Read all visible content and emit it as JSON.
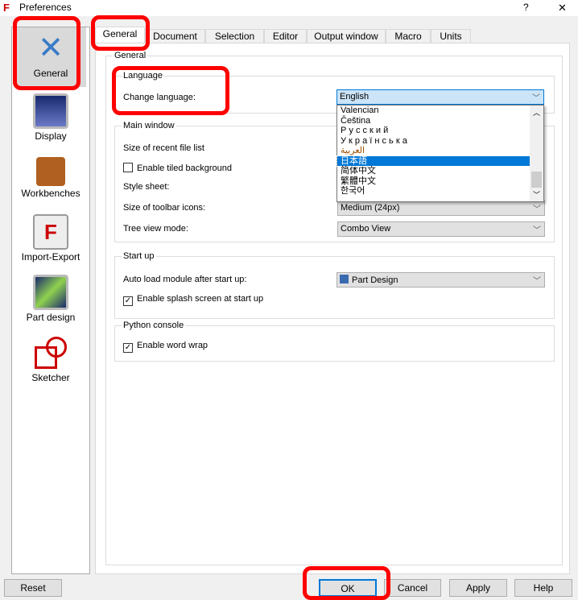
{
  "window": {
    "title": "Preferences",
    "help": "?",
    "close": "✕"
  },
  "sidebar": {
    "items": [
      {
        "label": "General",
        "icon": "wrench-screwdriver-icon"
      },
      {
        "label": "Display",
        "icon": "monitor-icon"
      },
      {
        "label": "Workbenches",
        "icon": "workbench-box-icon"
      },
      {
        "label": "Import-Export",
        "icon": "import-export-icon"
      },
      {
        "label": "Part design",
        "icon": "part-design-icon"
      },
      {
        "label": "Sketcher",
        "icon": "sketcher-icon"
      }
    ]
  },
  "tabs": [
    "General",
    "Document",
    "Selection",
    "Editor",
    "Output window",
    "Macro",
    "Units"
  ],
  "panel": {
    "group_title": "General",
    "language": {
      "title": "Language",
      "label": "Change language:",
      "value": "English",
      "options": [
        "Valencian",
        "Čeština",
        "Р у с с к и й",
        "У к р а ї н с ь к а",
        "العربية",
        "日本語",
        "简体中文",
        "繁體中文",
        "한국어"
      ],
      "selected": "日本語"
    },
    "main_window": {
      "title": "Main window",
      "recent_files": "Size of recent file list",
      "tiled_bg": "Enable tiled background",
      "tiled_checked": false,
      "style_sheet": "Style sheet:",
      "toolbar_icons": "Size of toolbar icons:",
      "toolbar_icons_value": "Medium (24px)",
      "tree_view": "Tree view mode:",
      "tree_view_value": "Combo View"
    },
    "startup": {
      "title": "Start up",
      "autoload": "Auto load module after start up:",
      "autoload_value": "Part Design",
      "splash": "Enable splash screen at start up",
      "splash_checked": true
    },
    "python": {
      "title": "Python console",
      "wrap": "Enable word wrap",
      "wrap_checked": true
    }
  },
  "buttons": {
    "reset": "Reset",
    "ok": "OK",
    "cancel": "Cancel",
    "apply": "Apply",
    "help": "Help"
  },
  "colors": {
    "highlight": "#ff0000",
    "accent": "#0078d7"
  }
}
